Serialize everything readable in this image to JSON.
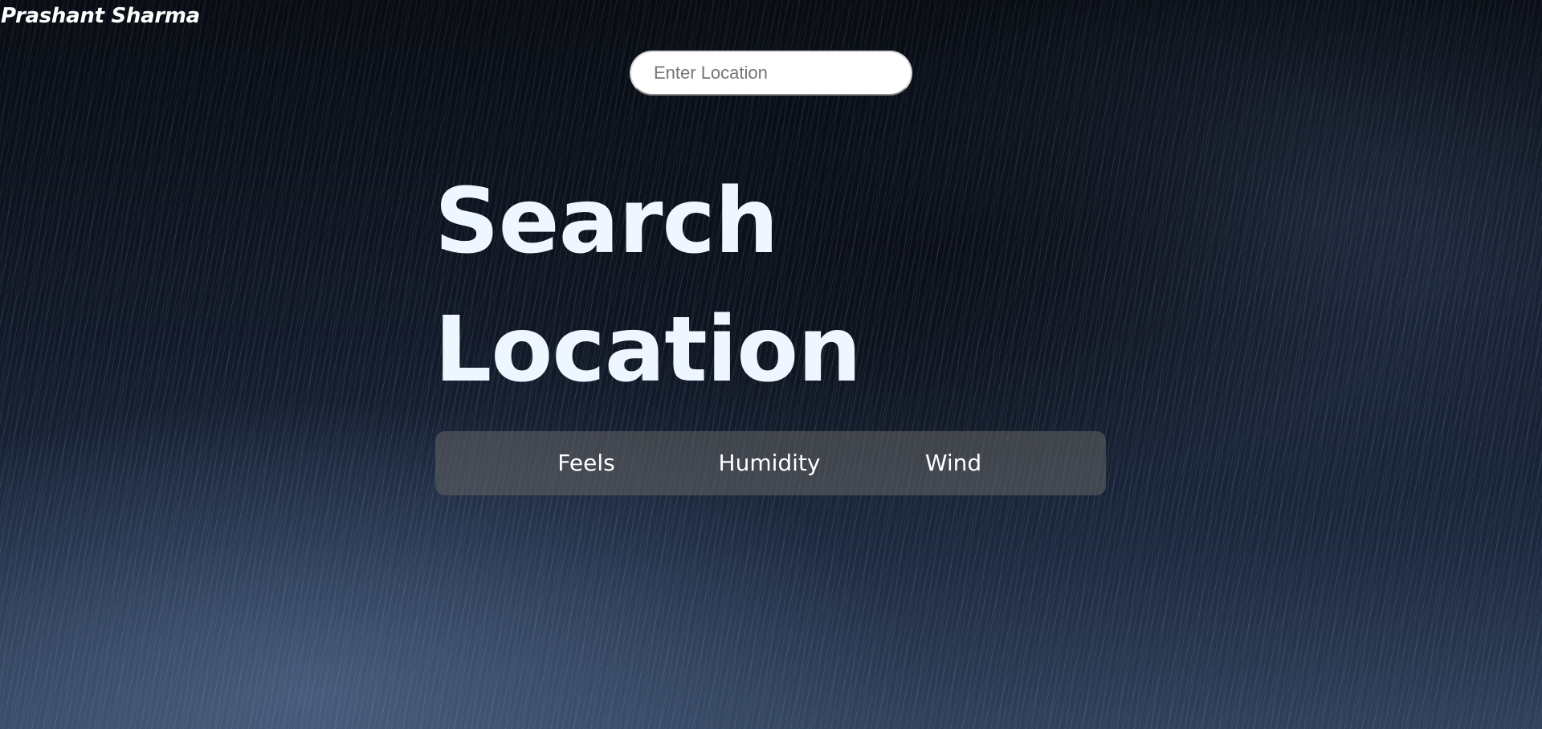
{
  "brand": {
    "name": "Prashant Sharma"
  },
  "search": {
    "placeholder": "Enter Location",
    "value": ""
  },
  "main": {
    "headline_line1": "Search",
    "headline_line2": "Location"
  },
  "stats": {
    "feels_label": "Feels",
    "humidity_label": "Humidity",
    "wind_label": "Wind"
  },
  "colors": {
    "text": "#eef6ff",
    "stats_bg": "#646464",
    "input_bg": "#ffffff"
  }
}
